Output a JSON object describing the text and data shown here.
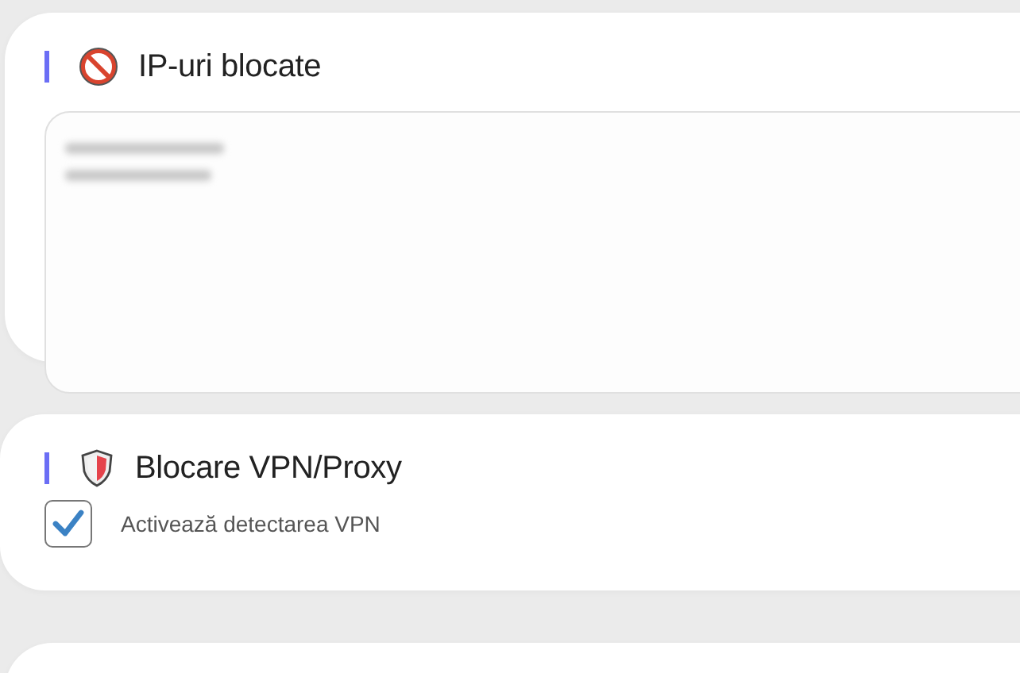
{
  "sections": [
    {
      "title": "IP-uri blocate",
      "kind": "textarea"
    },
    {
      "title": "Blocare VPN/Proxy",
      "kind": "checkbox",
      "checkbox": {
        "label": "Activează detectarea VPN",
        "checked": true
      }
    },
    {
      "kind": "empty"
    }
  ]
}
